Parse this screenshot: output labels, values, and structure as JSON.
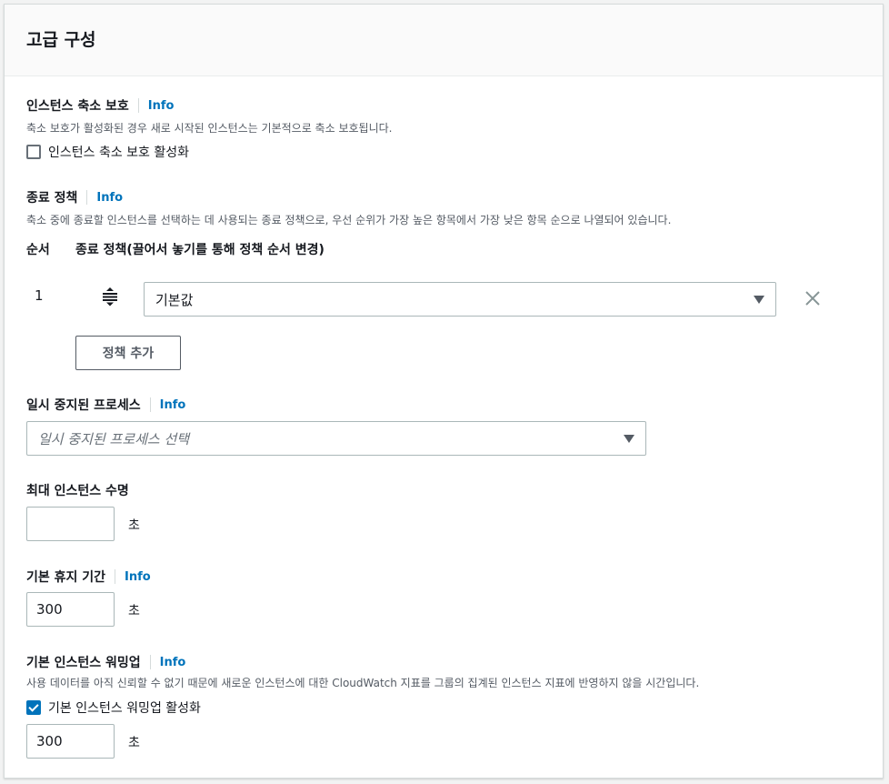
{
  "panel": {
    "title": "고급 구성"
  },
  "info_label": "Info",
  "scale_in_protection": {
    "label": "인스턴스 축소 보호",
    "description": "축소 보호가 활성화된 경우 새로 시작된 인스턴스는 기본적으로 축소 보호됩니다.",
    "checkbox_label": "인스턴스 축소 보호 활성화",
    "checked": false
  },
  "termination_policy": {
    "label": "종료 정책",
    "description": "축소 중에 종료할 인스턴스를 선택하는 데 사용되는 종료 정책으로, 우선 순위가 가장 높은 항목에서 가장 낮은 항목 순으로 나열되어 있습니다.",
    "col_order": "순서",
    "col_policy": "종료 정책(끌어서 놓기를 통해 정책 순서 변경)",
    "rows": [
      {
        "order": "1",
        "value": "기본값"
      }
    ],
    "add_button": "정책 추가"
  },
  "suspended_processes": {
    "label": "일시 중지된 프로세스",
    "placeholder": "일시 중지된 프로세스 선택"
  },
  "max_instance_lifetime": {
    "label": "최대 인스턴스 수명",
    "value": "",
    "unit": "초"
  },
  "default_cooldown": {
    "label": "기본 휴지 기간",
    "value": "300",
    "unit": "초"
  },
  "default_warmup": {
    "label": "기본 인스턴스 워밍업",
    "description": "사용 데이터를 아직 신뢰할 수 없기 때문에 새로운 인스턴스에 대한 CloudWatch 지표를 그룹의 집계된 인스턴스 지표에 반영하지 않을 시간입니다.",
    "checkbox_label": "기본 인스턴스 워밍업 활성화",
    "checked": true,
    "value": "300",
    "unit": "초"
  },
  "colors": {
    "link": "#0073bb",
    "checkbox": "#0073bb",
    "border": "#aab7b8"
  }
}
